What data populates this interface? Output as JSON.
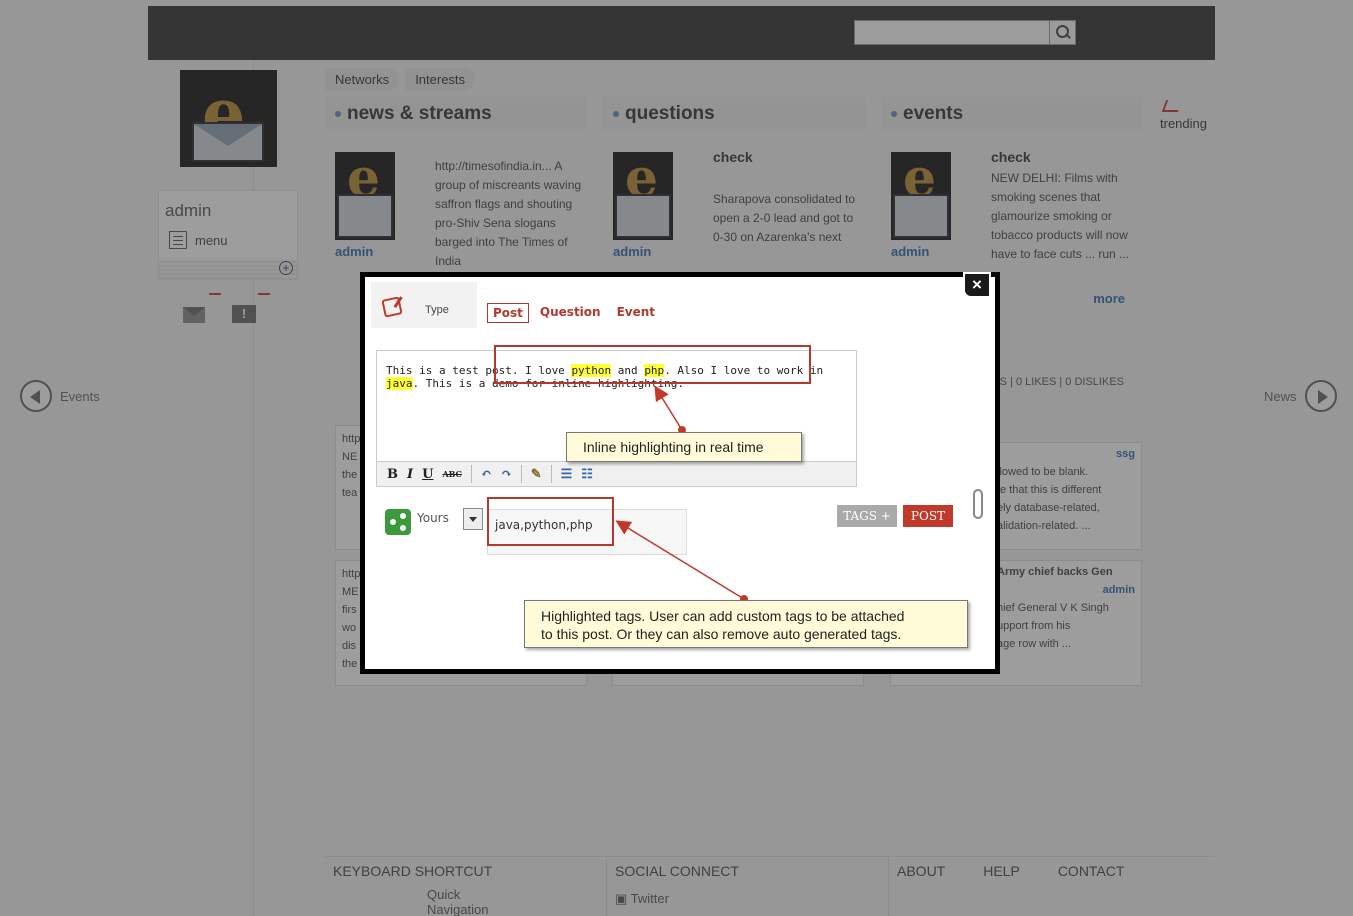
{
  "search": {
    "placeholder": ""
  },
  "sidebar": {
    "username": "admin",
    "menu_label": "menu",
    "events_nav": "Events",
    "news_nav": "News"
  },
  "top_tabs": [
    "Networks",
    "Interests"
  ],
  "columns": [
    {
      "title": "news & streams",
      "author": "admin",
      "item_title": "",
      "item_body": "http://timesofindia.in... A group of miscreants waving saffron flags and shouting pro-Shiv Sena slogans barged into The Times of India"
    },
    {
      "title": "questions",
      "author": "admin",
      "item_title": "check",
      "item_body": "Sharapova consolidated to open a 2-0 lead and got to 0-30 on Azarenka's next"
    },
    {
      "title": "events",
      "author": "admin",
      "item_title": "check",
      "item_body": "NEW DELHI: Films with smoking scenes that glamourize smoking or tobacco products will now have to face cuts ... run ...",
      "more": "more",
      "stats": "NTS | 0 LIKES | 0 DISLIKES"
    }
  ],
  "trending": {
    "label": "trending"
  },
  "cards": [
    {
      "lines": "http\nNE\nthe\ntea"
    },
    {
      "lines": "http\nME\nfirs\nwo\ndis\nthe"
    },
    {
      "author": "ssg",
      "lines": "llowed to be blank.\nte that this is different\nely database-related,\nalidation-related. ..."
    },
    {
      "title": "Army chief backs Gen",
      "author": "admin",
      "lines": "hief General V K Singh\nupport from his\nage row with ..."
    }
  ],
  "modal": {
    "type_label": "Type",
    "post_types": [
      "Post",
      "Question",
      "Event"
    ],
    "editor_text_parts": [
      {
        "text": "This is a test post. I love ",
        "hl": false
      },
      {
        "text": "python",
        "hl": true
      },
      {
        "text": " and ",
        "hl": false
      },
      {
        "text": "php",
        "hl": true
      },
      {
        "text": ". Also I love to work in ",
        "hl": false
      },
      {
        "text": "java",
        "hl": true
      },
      {
        "text": ". This is a demo for inline highlighting.",
        "hl": false
      }
    ],
    "toolbar": {
      "bold": "B",
      "italic": "I",
      "underline": "U",
      "strike": "ABC"
    },
    "visibility": "Yours",
    "tags_value": "java,python,php",
    "tags_button": "TAGS +",
    "post_button": "POST",
    "close": "×"
  },
  "callouts": {
    "inline": "Inline highlighting in real time",
    "tags_line1": "Highlighted tags. User can add custom tags to be attached",
    "tags_line2": "to this post. Or they can also remove auto generated tags."
  },
  "footer": {
    "keyboard": "KEYBOARD SHORTCUT",
    "quick_nav": "Quick Navigation",
    "social": "SOCIAL CONNECT",
    "twitter": "Twitter",
    "about": "ABOUT",
    "help": "HELP",
    "contact": "CONTACT"
  },
  "colors": {
    "accent": "#b03a2e",
    "link": "#2a6ab0",
    "highlight": "#ffff33"
  }
}
